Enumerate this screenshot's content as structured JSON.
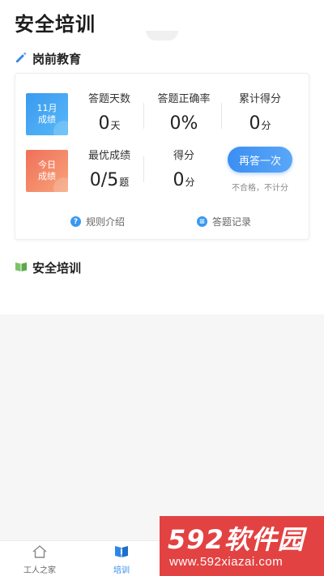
{
  "header": {
    "title": "安全培训"
  },
  "section_pre_job": {
    "label": "岗前教育"
  },
  "card": {
    "badge_month": {
      "line1": "11月",
      "line2": "成绩"
    },
    "badge_today": {
      "line1": "今日",
      "line2": "成绩"
    },
    "stats": {
      "days": {
        "label": "答题天数",
        "value": "0",
        "unit": "天"
      },
      "accuracy": {
        "label": "答题正确率",
        "value": "0%"
      },
      "total_score": {
        "label": "累计得分",
        "value": "0",
        "unit": "分"
      },
      "best": {
        "label": "最优成绩",
        "value": "0/5",
        "unit": "题"
      },
      "score": {
        "label": "得分",
        "value": "0",
        "unit": "分"
      }
    },
    "retry_button": "再答一次",
    "retry_note": "不合格，不计分",
    "links": {
      "rules": "规则介绍",
      "records": "答题记录"
    }
  },
  "section_training": {
    "label": "安全培训"
  },
  "bottom_nav": {
    "items": [
      {
        "label": "工人之家"
      },
      {
        "label": "培训"
      }
    ]
  },
  "watermark": {
    "logo": "592软件园",
    "url": "www.592xiazai.com"
  },
  "colors": {
    "accent": "#2b86e8",
    "badge_blue": "#3a9af0",
    "badge_red": "#f0705a",
    "watermark": "#e13232"
  }
}
